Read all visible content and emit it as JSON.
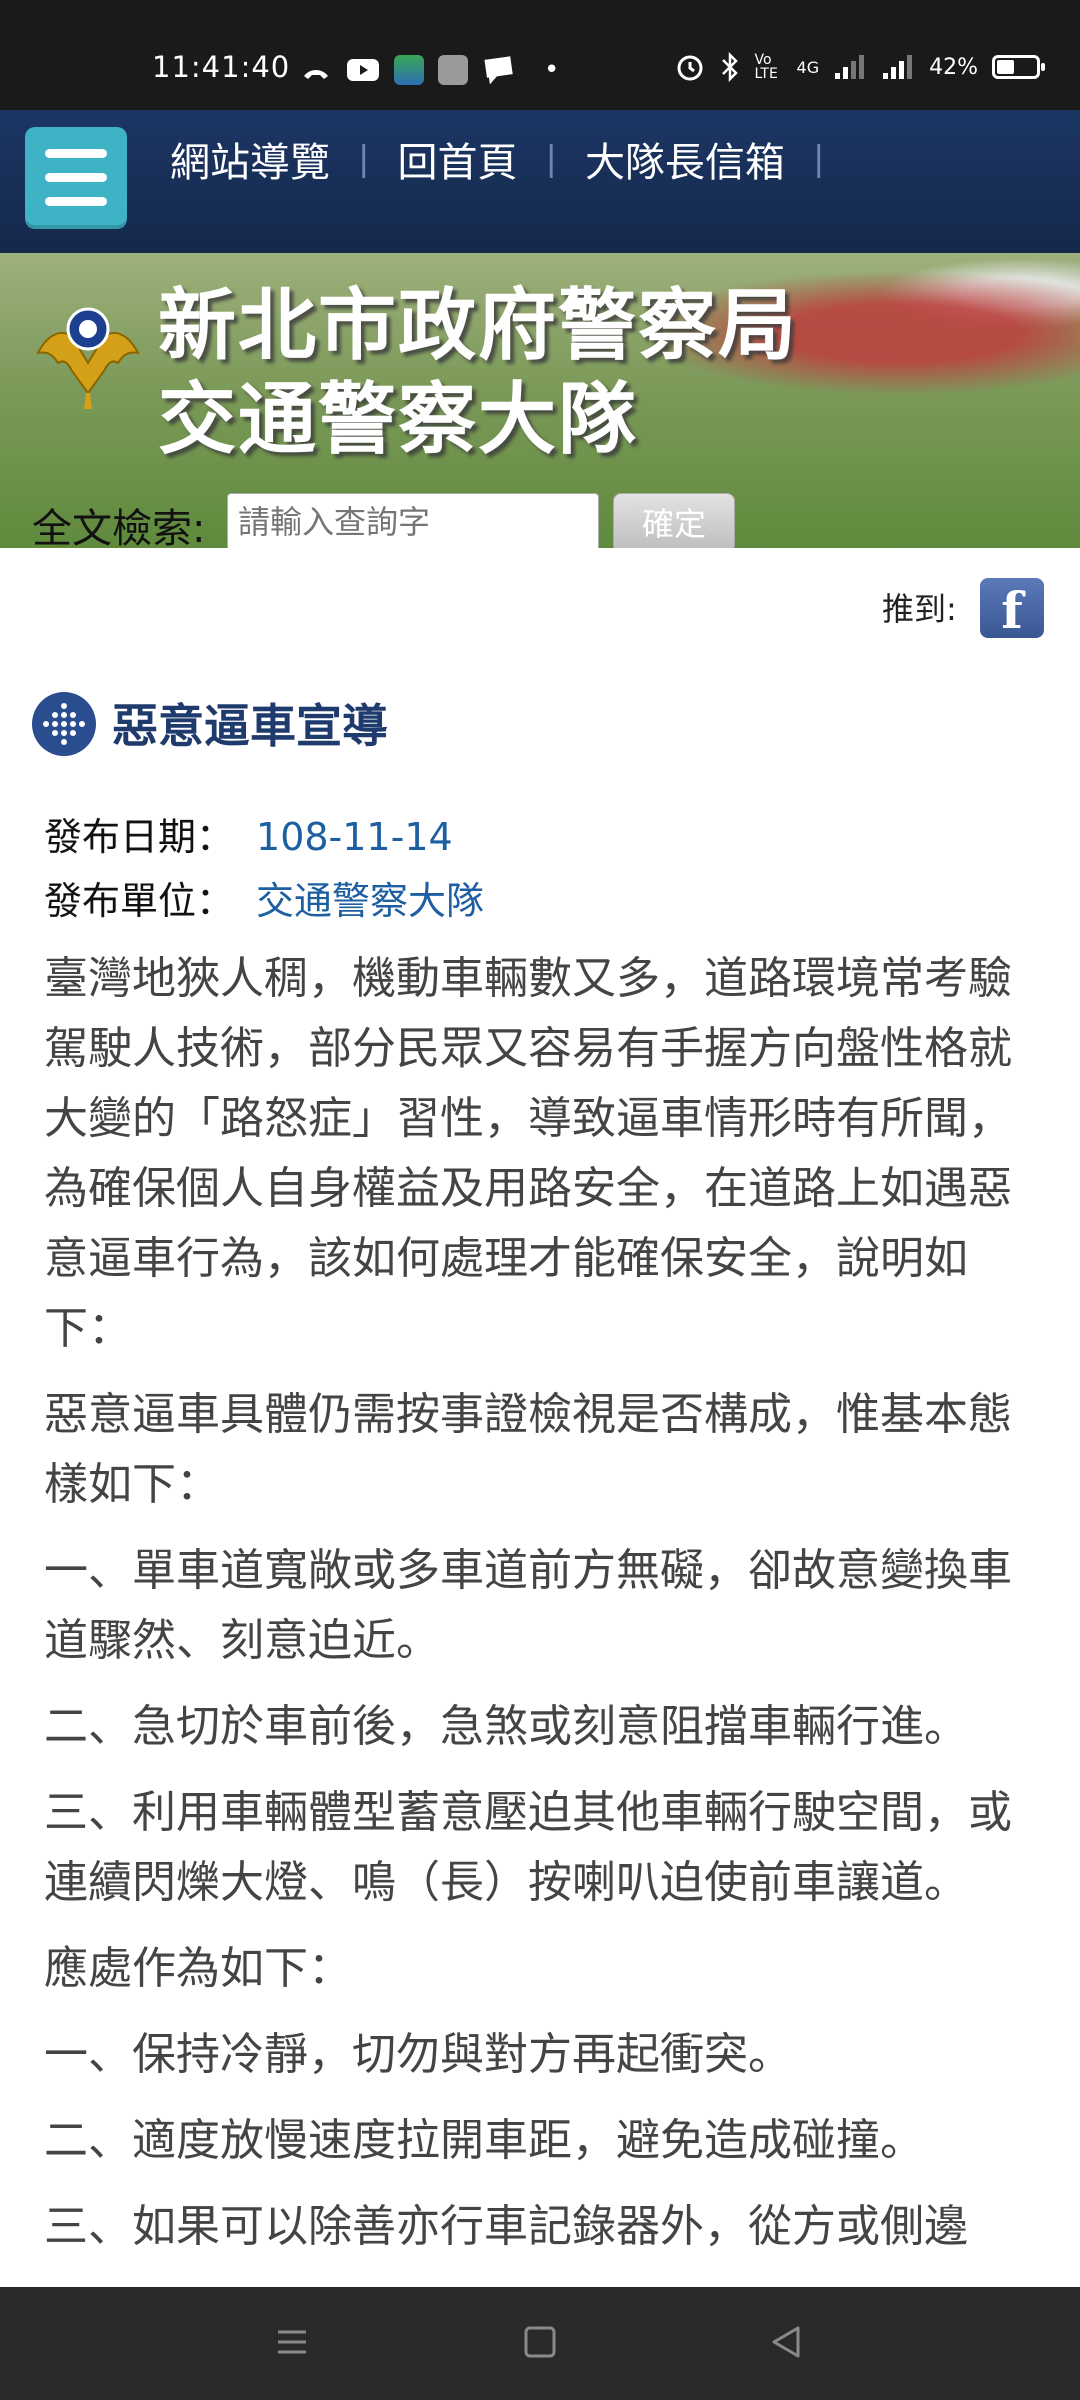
{
  "status_bar": {
    "time": "11:41:40",
    "battery": "42%",
    "network": "4G",
    "dot": "•",
    "volte": "Vo LTE"
  },
  "nav": {
    "links": [
      "網站導覽",
      "回首頁",
      "大隊長信箱"
    ],
    "separator": "|"
  },
  "banner": {
    "title_line1": "新北市政府警察局",
    "title_line2": "交通警察大隊"
  },
  "search": {
    "label": "全文檢索:",
    "placeholder": "請輸入查詢字",
    "button": "確定"
  },
  "share": {
    "label": "推到:",
    "fb_glyph": "f"
  },
  "article": {
    "title": "惡意逼車宣導",
    "date_label": "發布日期：",
    "date_value": "108-11-14",
    "unit_label": "發布單位：",
    "unit_value": "交通警察大隊",
    "paragraphs": [
      "臺灣地狹人稠，機動車輛數又多，道路環境常考驗駕駛人技術，部分民眾又容易有手握方向盤性格就大變的「路怒症」習性，導致逼車情形時有所聞，為確保個人自身權益及用路安全，在道路上如遇惡意逼車行為，該如何處理才能確保安全，說明如下：",
      "惡意逼車具體仍需按事證檢視是否構成，惟基本態樣如下：",
      "一、單車道寬敞或多車道前方無礙，卻故意變換車道驟然、刻意迫近。",
      "二、急切於車前後，急煞或刻意阻擋車輛行進。",
      "三、利用車輛體型蓄意壓迫其他車輛行駛空間，或連續閃爍大燈、鳴（長）按喇叭迫使前車讓道。",
      "應處作為如下：",
      "一、保持冷靜，切勿與對方再起衝突。",
      "二、適度放慢速度拉開車距，避免造成碰撞。",
      "三、如果可以除善亦行車記錄器外，從方或側邊"
    ]
  },
  "colors": {
    "header_bg": "#1c3664",
    "menu_button": "#3fb3c6",
    "title": "#1f3b6e",
    "link_value": "#1d5fa0"
  }
}
